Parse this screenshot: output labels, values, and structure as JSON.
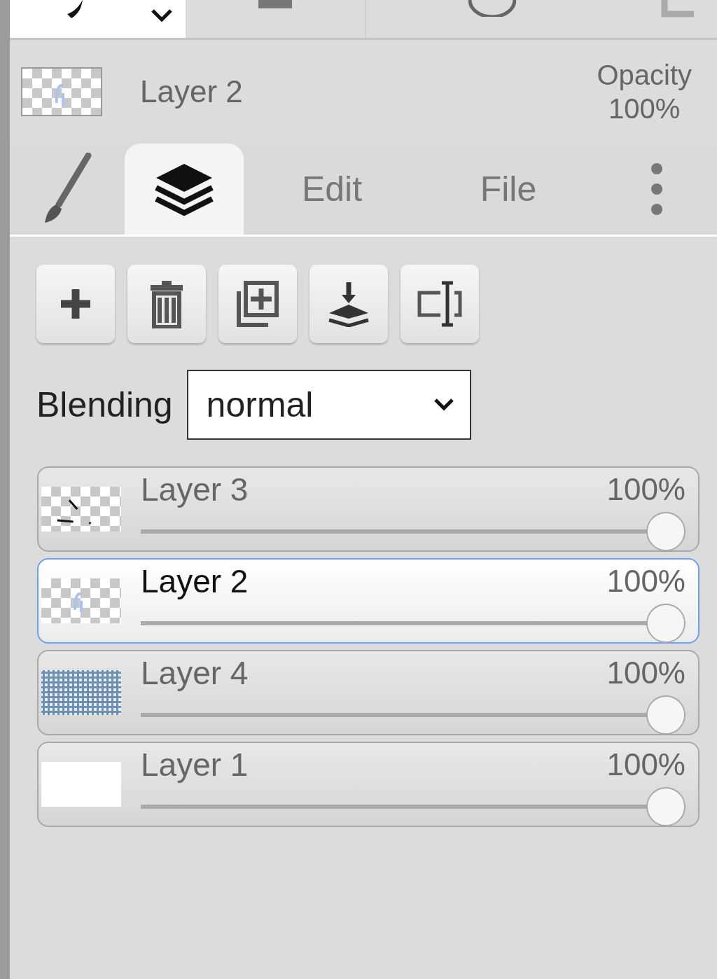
{
  "header": {
    "name": "Layer 2",
    "opacity_label": "Opacity",
    "opacity_value": "100%"
  },
  "tabs": [
    {
      "kind": "brush",
      "selected": false
    },
    {
      "kind": "layers",
      "selected": true
    },
    {
      "kind": "text",
      "label": "Edit",
      "selected": false
    },
    {
      "kind": "text",
      "label": "File",
      "selected": false
    },
    {
      "kind": "more",
      "selected": false
    }
  ],
  "actions": [
    {
      "kind": "add"
    },
    {
      "kind": "delete"
    },
    {
      "kind": "duplicate"
    },
    {
      "kind": "merge-down"
    },
    {
      "kind": "rename"
    }
  ],
  "blending": {
    "label": "Blending",
    "value": "normal"
  },
  "layers": [
    {
      "name": "Layer 3",
      "opacity": "100%",
      "level": 1,
      "selected": false
    },
    {
      "name": "Layer 2",
      "opacity": "100%",
      "level": 1,
      "selected": true
    },
    {
      "name": "Layer 4",
      "opacity": "100%",
      "level": 1,
      "selected": false
    },
    {
      "name": "Layer 1",
      "opacity": "100%",
      "level": 1,
      "selected": false
    }
  ]
}
